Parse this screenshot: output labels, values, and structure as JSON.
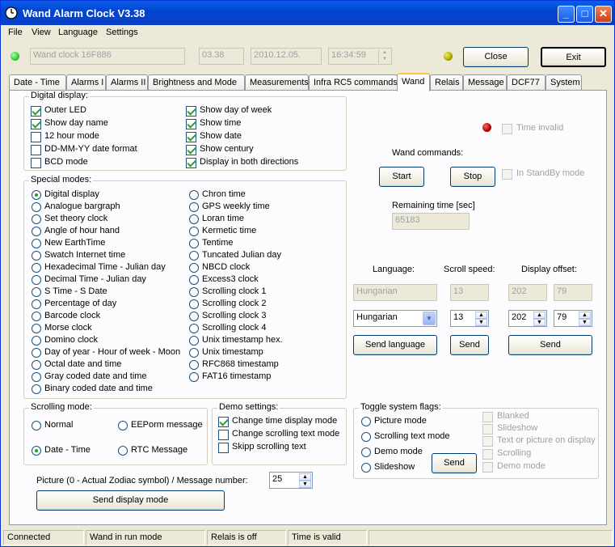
{
  "window": {
    "title": "Wand Alarm Clock V3.38"
  },
  "menu": [
    "File",
    "View",
    "Language",
    "Settings"
  ],
  "header": {
    "device_name": "Wand clock 16F886",
    "version": "03.38",
    "date": "2010.12.05.",
    "time": "16:34:59",
    "close_label": "Close",
    "exit_label": "Exit"
  },
  "tabs": [
    "Date - Time",
    "Alarms I",
    "Alarms II",
    "Brightness and Mode",
    "Measurements",
    "Infra RC5 commands",
    "Wand",
    "Relais",
    "Message",
    "DCF77",
    "System"
  ],
  "digital_display": {
    "label": "Digital display:",
    "left": [
      {
        "label": "Outer LED",
        "checked": true
      },
      {
        "label": "Show day name",
        "checked": true
      },
      {
        "label": "12 hour mode",
        "checked": false
      },
      {
        "label": "DD-MM-YY date format",
        "checked": false
      },
      {
        "label": "BCD mode",
        "checked": false
      }
    ],
    "right": [
      {
        "label": "Show day of week",
        "checked": true
      },
      {
        "label": "Show time",
        "checked": true
      },
      {
        "label": "Show date",
        "checked": true
      },
      {
        "label": "Show century",
        "checked": true
      },
      {
        "label": "Display in both directions",
        "checked": true
      }
    ]
  },
  "special_modes": {
    "label": "Special modes:",
    "left": [
      "Digital display",
      "Analogue bargraph",
      "Set theory clock",
      "Angle of hour hand",
      "New EarthTime",
      "Swatch Internet time",
      "Hexadecimal Time - Julian day",
      "Decimal Time - Julian day",
      "S Time - S Date",
      "Percentage of day",
      "Barcode clock",
      "Morse clock",
      "Domino clock",
      "Day of year - Hour of week - Moon",
      "Octal date and time",
      "Gray coded date and time",
      "Binary coded date and time"
    ],
    "right": [
      "Chron time",
      "GPS weekly time",
      "Loran time",
      "Kermetic time",
      "Tentime",
      "Tuncated Julian day",
      "NBCD clock",
      "Excess3 clock",
      "Scrolling clock 1",
      "Scrolling clock 2",
      "Scrolling clock 3",
      "Scrolling clock 4",
      "Unix timestamp hex.",
      "Unix timestamp",
      "RFC868 timestamp",
      "FAT16 timestamp"
    ],
    "selected": "Digital display"
  },
  "scrolling_mode": {
    "label": "Scrolling mode:",
    "options": [
      "Normal",
      "EEPorm message",
      "Date - Time",
      "RTC Message"
    ],
    "selected": "Date - Time"
  },
  "demo_settings": {
    "label": "Demo settings:",
    "items": [
      {
        "label": "Change time display mode",
        "checked": true
      },
      {
        "label": "Change scrolling text mode",
        "checked": false
      },
      {
        "label": "Skipp scrolling text",
        "checked": false
      }
    ]
  },
  "picture": {
    "label": "Picture (0 - Actual Zodiac symbol)  /  Message number:",
    "value": "25",
    "send_label": "Send display mode"
  },
  "wand": {
    "time_invalid_label": "Time invalid",
    "commands_label": "Wand commands:",
    "start_label": "Start",
    "stop_label": "Stop",
    "standby_label": "In StandBy mode",
    "remaining_label": "Remaining time [sec]",
    "remaining_value": "65183"
  },
  "language_section": {
    "language_label": "Language:",
    "scroll_label": "Scroll speed:",
    "offset_label": "Display offset:",
    "current_language": "Hungarian",
    "current_speed": "13",
    "current_offset_1": "202",
    "current_offset_2": "79",
    "selected_language": "Hungarian",
    "selected_speed": "13",
    "selected_offset_1": "202",
    "selected_offset_2": "79",
    "send_language_label": "Send language",
    "send_speed_label": "Send",
    "send_offset_label": "Send"
  },
  "toggle_flags": {
    "label": "Toggle system flags:",
    "radios": [
      "Picture mode",
      "Scrolling text mode",
      "Demo mode",
      "Slideshow"
    ],
    "send_label": "Send",
    "checks": [
      "Blanked",
      "Slideshow",
      "Text or picture on display",
      "Scrolling",
      "Demo mode"
    ]
  },
  "status": [
    "Connected",
    "Wand in run mode",
    "Relais is off",
    "Time is valid"
  ],
  "colors": {
    "led_green": "#33cc33",
    "led_olive": "#a8a800",
    "led_red": "#b00000",
    "title_blue": "#0a5fe8"
  }
}
